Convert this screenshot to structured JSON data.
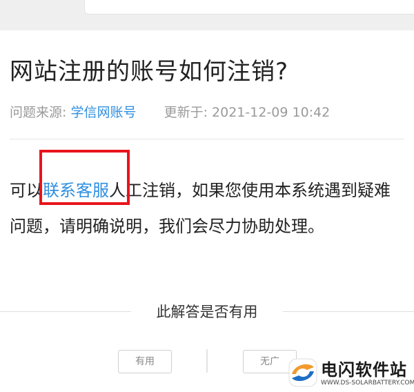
{
  "question": {
    "title": "网站注册的账号如何注销?",
    "source_label": "问题来源:",
    "source_value": "学信网账号",
    "updated_label": "更新于:",
    "updated_value": "2021-12-09 10:42"
  },
  "answer": {
    "prefix": "可以",
    "link_text": "联系客服",
    "suffix": "人工注销，如果您使用本系统遇到疑难问题，请明确说明，我们会尽力协助处理。"
  },
  "feedback": {
    "prompt": "此解答是否有用",
    "yes_label": "有用",
    "no_label": "无广"
  },
  "watermark": {
    "title": "电闪软件站",
    "url": "WWW.DS-SOLARBATTERY.COM"
  },
  "colors": {
    "link": "#2f8fe0",
    "highlight": "#e8141c",
    "logo_orange": "#f29a2e",
    "logo_blue": "#1e6fc4"
  }
}
